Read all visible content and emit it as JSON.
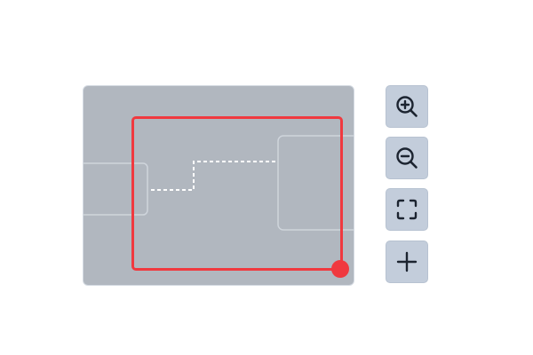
{
  "minimap": {
    "label": "",
    "background_color": "#b1b7bf",
    "viewport_color": "#f0393f",
    "node_stroke_color": "#cfd5dc",
    "edge_color": "#ffffff",
    "nodes": [
      {
        "id": "node-left"
      },
      {
        "id": "node-right"
      }
    ],
    "edges": [
      {
        "from": "node-left",
        "to": "node-right",
        "style": "dashed"
      }
    ]
  },
  "controls": {
    "background_color": "#c3cddb",
    "icon_color": "#1c2430",
    "buttons": [
      {
        "id": "zoom-in",
        "icon": "zoom-in-icon",
        "label": ""
      },
      {
        "id": "zoom-out",
        "icon": "zoom-out-icon",
        "label": ""
      },
      {
        "id": "fit-view",
        "icon": "fit-view-icon",
        "label": ""
      },
      {
        "id": "add",
        "icon": "plus-icon",
        "label": ""
      }
    ]
  }
}
